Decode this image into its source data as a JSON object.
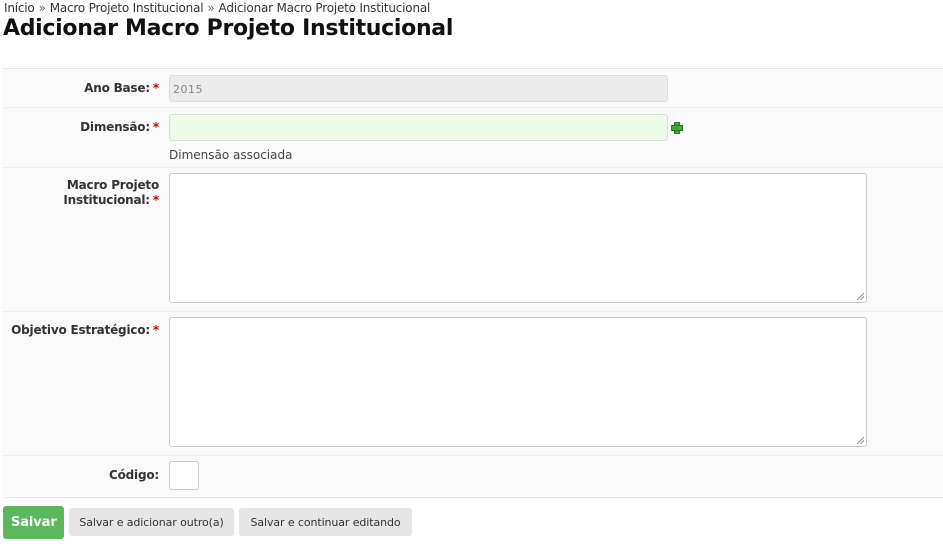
{
  "breadcrumb": {
    "items": [
      "Início",
      "Macro Projeto Institucional",
      "Adicionar Macro Projeto Institucional"
    ],
    "separator": "»"
  },
  "page_title": "Adicionar Macro Projeto Institucional",
  "form": {
    "ano_base": {
      "label": "Ano Base:",
      "value": "2015"
    },
    "dimensao": {
      "label": "Dimensão:",
      "value": "",
      "help": "Dimensão associada",
      "add_icon": "plus-icon"
    },
    "macro_projeto": {
      "label_line1": "Macro Projeto",
      "label_line2": "Institucional:",
      "value": ""
    },
    "objetivo": {
      "label": "Objetivo Estratégico:",
      "value": ""
    },
    "codigo": {
      "label": "Código:",
      "value": ""
    },
    "required_marker": "*"
  },
  "buttons": {
    "save": "Salvar",
    "save_add_another": "Salvar e adicionar outro(a)",
    "save_continue": "Salvar e continuar editando"
  },
  "colors": {
    "primary_button": "#5cb85c",
    "required": "#cc0000",
    "dimension_field_bg": "#eefbe8",
    "plus_icon": "#3da33b"
  }
}
